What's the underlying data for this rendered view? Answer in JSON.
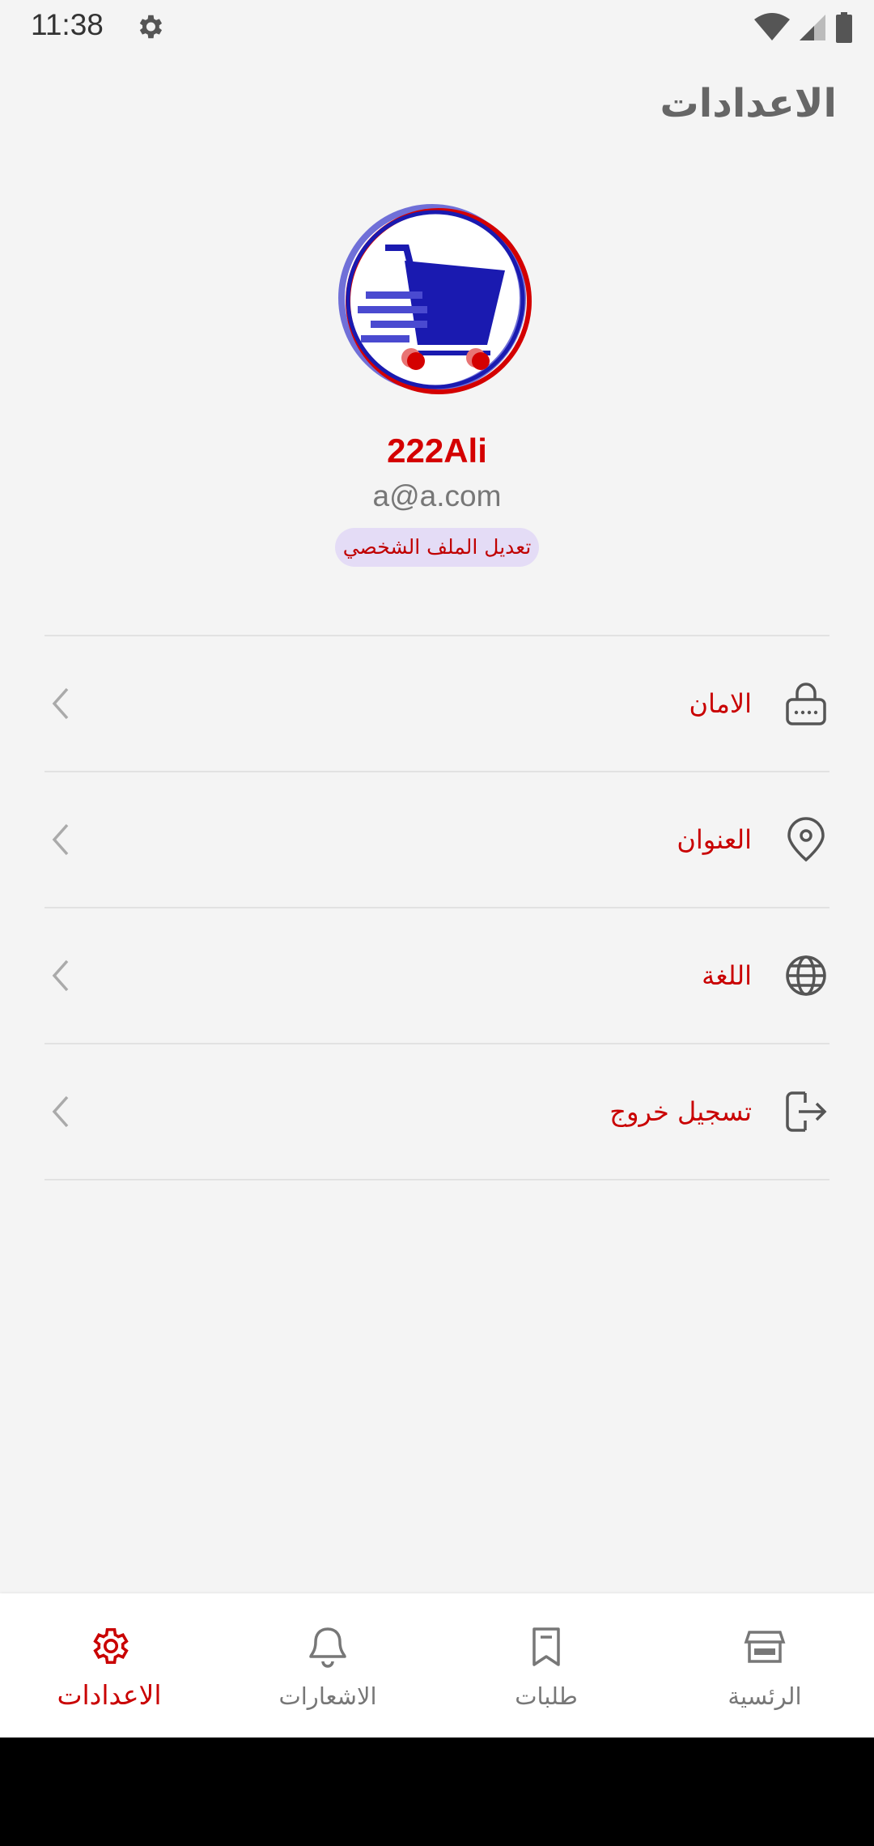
{
  "status_bar": {
    "time": "11:38",
    "icons": [
      "settings-icon",
      "wifi-icon",
      "signal-icon",
      "battery-icon"
    ]
  },
  "header": {
    "title": "الاعدادات"
  },
  "profile": {
    "name": "222Ali",
    "email": "a@a.com",
    "edit_label": "تعديل الملف الشخصي",
    "avatar_icon": "shopping-cart-logo"
  },
  "menu": {
    "items": [
      {
        "label": "الامان",
        "icon": "lock-icon"
      },
      {
        "label": "العنوان",
        "icon": "location-pin-icon"
      },
      {
        "label": "اللغة",
        "icon": "globe-icon"
      },
      {
        "label": "تسجيل خروج",
        "icon": "logout-icon"
      }
    ]
  },
  "bottom_nav": {
    "items": [
      {
        "label": "الرئسية",
        "icon": "store-icon",
        "active": false
      },
      {
        "label": "طلبات",
        "icon": "bookmark-icon",
        "active": false
      },
      {
        "label": "الاشعارات",
        "icon": "bell-icon",
        "active": false
      },
      {
        "label": "الاعدادات",
        "icon": "settings-icon",
        "active": true
      }
    ]
  },
  "colors": {
    "accent": "#c90000",
    "background": "#f4f4f4",
    "edit_chip_bg": "#e4dcf6",
    "logo_blue": "#1a1ab0"
  }
}
